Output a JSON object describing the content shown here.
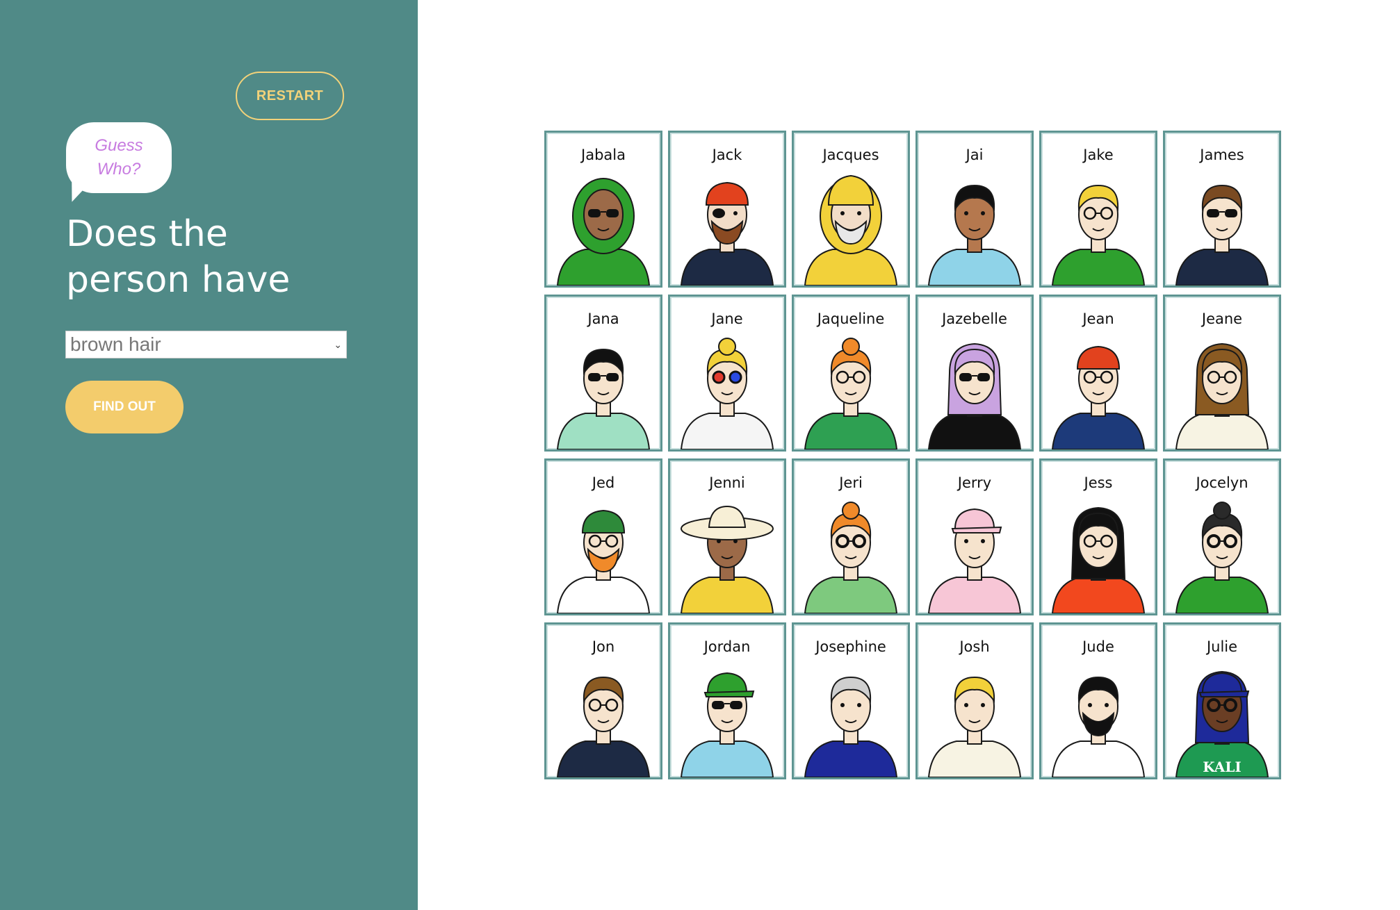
{
  "sidebar": {
    "restart_label": "RESTART",
    "logo_line1": "Guess",
    "logo_line2": "Who?",
    "question_line1": "Does the",
    "question_line2": "person have",
    "select_value": "brown hair",
    "findout_label": "FIND OUT",
    "background_color": "#508a87",
    "accent_color": "#f3cc6c"
  },
  "board": {
    "characters": [
      {
        "name": "Jabala",
        "skin": "#9c6a48",
        "hair": "#2ea02e",
        "shirt": "#2ea02e",
        "hat": "none",
        "glasses": "sun"
      },
      {
        "name": "Jack",
        "skin": "#f2ddc8",
        "hair": "#e2421e",
        "shirt": "#1d2a44",
        "hat": "bandana",
        "glasses": "patch"
      },
      {
        "name": "Jacques",
        "skin": "#f2ddc8",
        "hair": "#f2d13a",
        "shirt": "#f2d13a",
        "hat": "hood",
        "glasses": "none"
      },
      {
        "name": "Jai",
        "skin": "#b5784e",
        "hair": "#111111",
        "shirt": "#8fd3e8",
        "hat": "none",
        "glasses": "none"
      },
      {
        "name": "Jake",
        "skin": "#f6e3cd",
        "hair": "#f2d13a",
        "shirt": "#2ea02e",
        "hat": "none",
        "glasses": "clear"
      },
      {
        "name": "James",
        "skin": "#f6e3cd",
        "hair": "#7a4a22",
        "shirt": "#1d2a44",
        "hat": "none",
        "glasses": "sun"
      },
      {
        "name": "Jana",
        "skin": "#f6e3cd",
        "hair": "#111111",
        "shirt": "#9fe0c3",
        "hat": "none",
        "glasses": "sun"
      },
      {
        "name": "Jane",
        "skin": "#f6e3cd",
        "hair": "#f2d13a",
        "shirt": "#f5f5f5",
        "hat": "none",
        "glasses": "3d"
      },
      {
        "name": "Jaqueline",
        "skin": "#f6e3cd",
        "hair": "#f08a2a",
        "shirt": "#2ea052",
        "hat": "none",
        "glasses": "clear"
      },
      {
        "name": "Jazebelle",
        "skin": "#f6e3cd",
        "hair": "#c9a3e0",
        "shirt": "#111111",
        "hat": "none",
        "glasses": "sun"
      },
      {
        "name": "Jean",
        "skin": "#f6e3cd",
        "hair": "#e2421e",
        "shirt": "#1d3a7a",
        "hat": "beanie",
        "glasses": "clear"
      },
      {
        "name": "Jeane",
        "skin": "#f6e3cd",
        "hair": "#8a5a22",
        "shirt": "#f7f3e3",
        "hat": "none",
        "glasses": "clear"
      },
      {
        "name": "Jed",
        "skin": "#f6e3cd",
        "hair": "#f08a2a",
        "shirt": "#ffffff",
        "hat": "beanie-green",
        "glasses": "clear"
      },
      {
        "name": "Jenni",
        "skin": "#9c6a48",
        "hair": "#333333",
        "shirt": "#f2d13a",
        "hat": "sunhat",
        "glasses": "none"
      },
      {
        "name": "Jeri",
        "skin": "#f6e3cd",
        "hair": "#f08a2a",
        "shirt": "#7ec97e",
        "hat": "none",
        "glasses": "round"
      },
      {
        "name": "Jerry",
        "skin": "#f6e3cd",
        "hair": "#f2b9c9",
        "shirt": "#f7c6d6",
        "hat": "cap-pink",
        "glasses": "none"
      },
      {
        "name": "Jess",
        "skin": "#f6e3cd",
        "hair": "#111111",
        "shirt": "#f2481e",
        "hat": "none",
        "glasses": "clear"
      },
      {
        "name": "Jocelyn",
        "skin": "#f6e3cd",
        "hair": "#2a2a2a",
        "shirt": "#2ea02e",
        "hat": "none",
        "glasses": "round"
      },
      {
        "name": "Jon",
        "skin": "#f6e3cd",
        "hair": "#8a5a22",
        "shirt": "#1d2a44",
        "hat": "none",
        "glasses": "clear"
      },
      {
        "name": "Jordan",
        "skin": "#f6e3cd",
        "hair": "#f2d13a",
        "shirt": "#8fd3e8",
        "hat": "cap-green",
        "glasses": "sun"
      },
      {
        "name": "Josephine",
        "skin": "#f6e3cd",
        "hair": "#cfcfcf",
        "shirt": "#1e2a9a",
        "hat": "none",
        "glasses": "none"
      },
      {
        "name": "Josh",
        "skin": "#f6e3cd",
        "hair": "#f2d13a",
        "shirt": "#f7f3e3",
        "hat": "none",
        "glasses": "none"
      },
      {
        "name": "Jude",
        "skin": "#f6e3cd",
        "hair": "#111111",
        "shirt": "#ffffff",
        "hat": "none",
        "glasses": "none"
      },
      {
        "name": "Julie",
        "skin": "#6a3e24",
        "hair": "#1e2a9a",
        "shirt": "#1e9a52",
        "hat": "cap-blue",
        "glasses": "round"
      }
    ],
    "card_text_julie_shirt": "KALI"
  }
}
